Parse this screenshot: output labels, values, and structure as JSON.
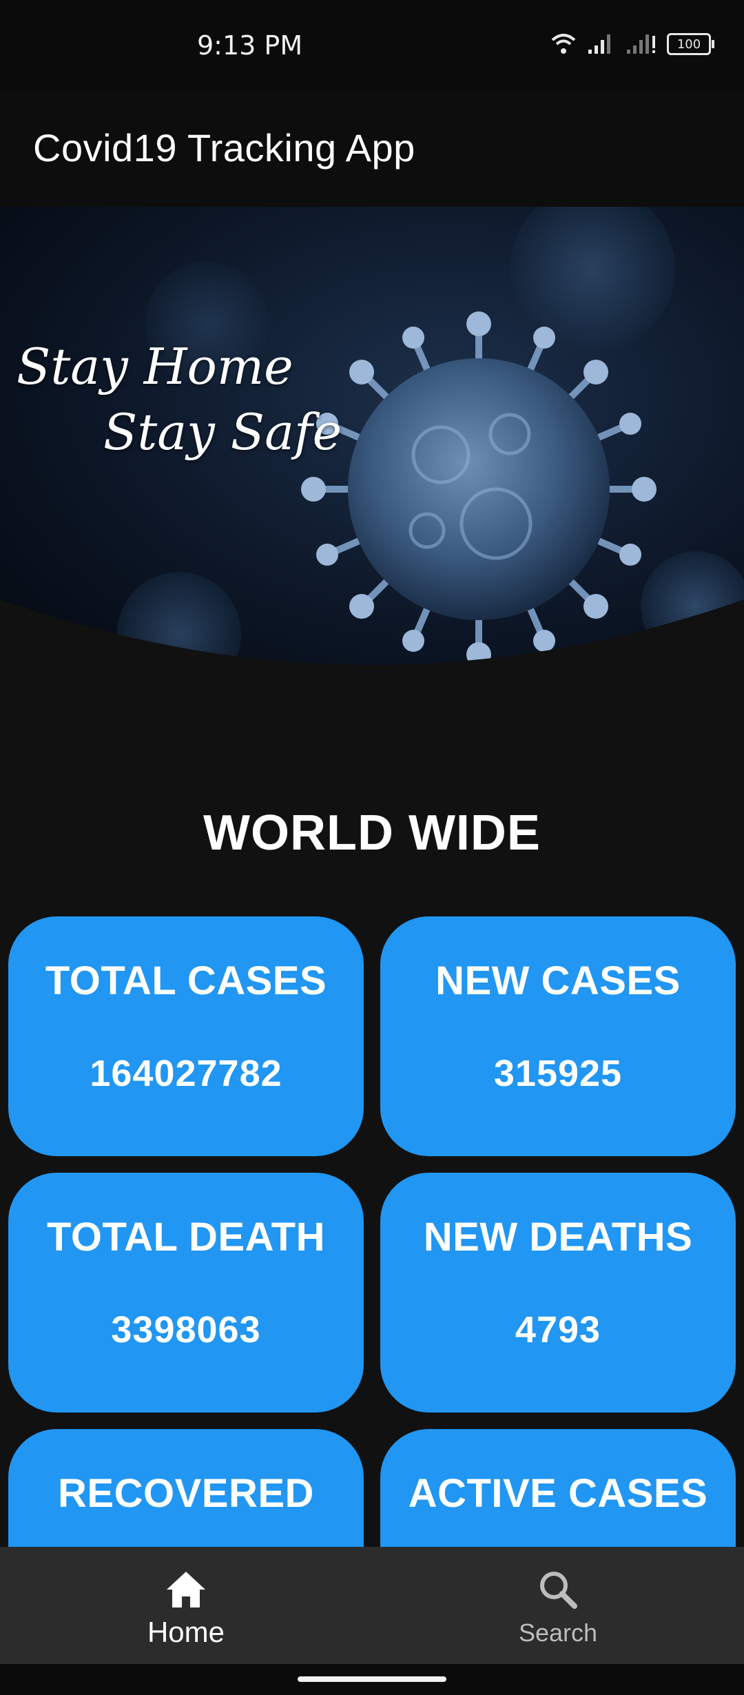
{
  "status_bar": {
    "time": "9:13 PM",
    "battery": "100",
    "icons": [
      "wifi-icon",
      "signal-icon",
      "signal-icon",
      "battery-icon"
    ]
  },
  "app_bar": {
    "title": "Covid19 Tracking App"
  },
  "hero": {
    "line1": "Stay Home",
    "line2": "Stay Safe",
    "image": "coronavirus-banner"
  },
  "section": {
    "title": "WORLD WIDE"
  },
  "stats": [
    {
      "label": "TOTAL CASES",
      "value": "164027782"
    },
    {
      "label": "NEW CASES",
      "value": "315925"
    },
    {
      "label": "TOTAL DEATH",
      "value": "3398063"
    },
    {
      "label": "NEW DEATHS",
      "value": "4793"
    },
    {
      "label": "RECOVERED",
      "value": ""
    },
    {
      "label": "ACTIVE CASES",
      "value": ""
    }
  ],
  "bottom_nav": {
    "items": [
      {
        "label": "Home",
        "icon": "home-icon",
        "active": true
      },
      {
        "label": "Search",
        "icon": "search-icon",
        "active": false
      }
    ]
  },
  "colors": {
    "background": "#111111",
    "card": "#2196f3",
    "nav": "#2c2c2c",
    "text": "#ffffff"
  }
}
